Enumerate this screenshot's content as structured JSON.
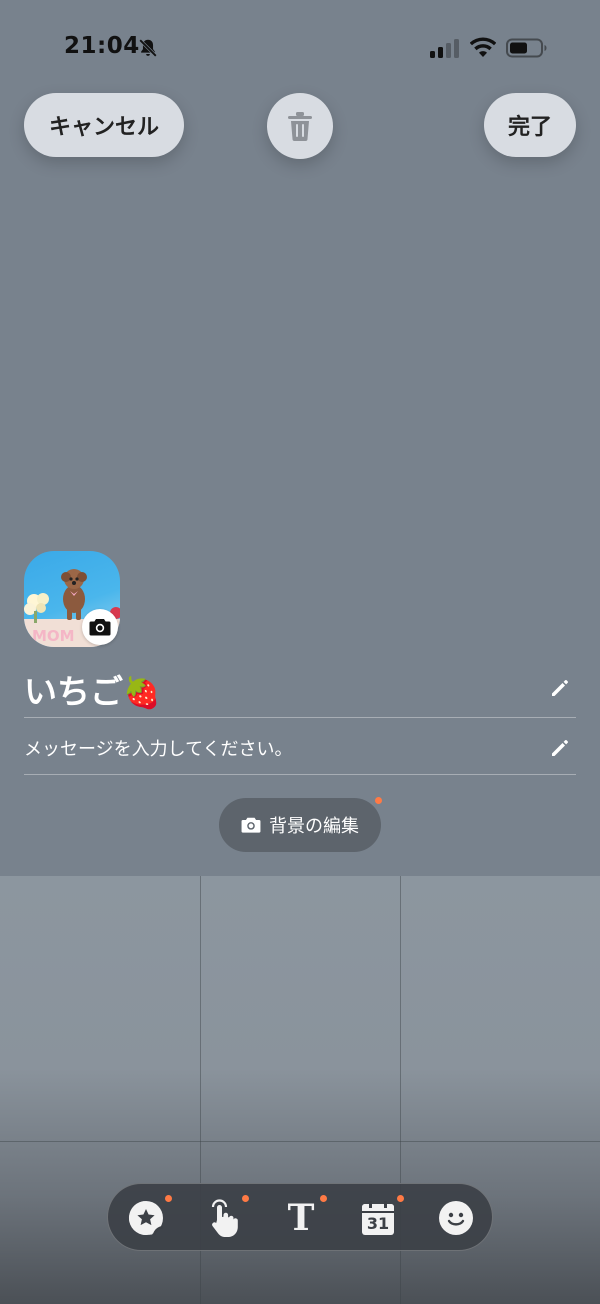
{
  "status_bar": {
    "time": "21:04",
    "icons": [
      "bell-slash-icon",
      "signal-icon",
      "wifi-icon",
      "battery-icon"
    ]
  },
  "header": {
    "cancel_label": "キャンセル",
    "done_label": "完了",
    "trash_icon": "trash-icon"
  },
  "profile": {
    "name": "いちご",
    "name_emoji": "🍓",
    "status_placeholder": "メッセージを入力してください。",
    "avatar_icon": "camera-icon",
    "avatar_caption": "MOM"
  },
  "background_edit": {
    "label": "背景の編集",
    "icon": "camera-icon"
  },
  "toolbar": {
    "items": [
      {
        "icon": "sticker-star-icon"
      },
      {
        "icon": "touch-hand-icon"
      },
      {
        "icon": "text-icon",
        "glyph": "T"
      },
      {
        "icon": "calendar-icon",
        "glyph": "31"
      },
      {
        "icon": "smiley-icon"
      }
    ]
  },
  "colors": {
    "background": "#78828d",
    "pill": "#d8dce2",
    "notification_dot": "#ff7a45",
    "toolbar": "#3c4046"
  }
}
